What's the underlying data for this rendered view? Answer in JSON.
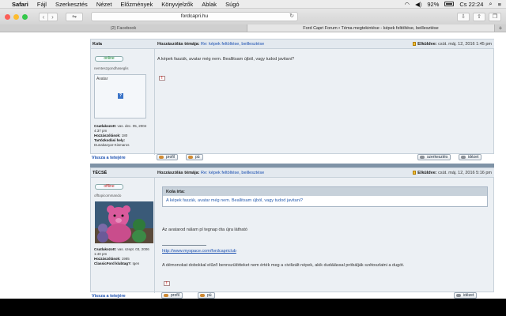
{
  "menubar": {
    "items": [
      "Safari",
      "Fájl",
      "Szerkesztés",
      "Nézet",
      "Előzmények",
      "Könyvjelzők",
      "Ablak",
      "Súgó"
    ],
    "battery": "92%",
    "clock": "Cs 22:24"
  },
  "toolbar": {
    "url": "fordcapri.hu"
  },
  "tabs": [
    {
      "label": "(2) Facebook"
    },
    {
      "label": "Ford Capri Forum • Téma megtekintése - képek feltöltése, beillesztése"
    }
  ],
  "posts": [
    {
      "author": "Kola",
      "status": "online",
      "rank": "nemteszgondhaseglis",
      "avatar_label": "Avatar",
      "subject_label": "Hozzászólás témája:",
      "subject": "Re: képek feltöltése, beillesztése",
      "sent_label": "Elküldve:",
      "sent": "csüt. máj. 12, 2016 1:45 pm",
      "body": "A képek faszák, avatar még nem. Beallitsam újból, vagy tudod javitani?",
      "stats": [
        {
          "k": "Csatlakozott:",
          "v": "vas. dec. 05, 2004 4:37 pm"
        },
        {
          "k": "Hozzászólások:",
          "v": "180"
        },
        {
          "k": "Tartózkodási hely:",
          "v": "Dunakanyar-Kismaros"
        }
      ],
      "back_to_top": "Vissza a tetejére",
      "buttons": {
        "profile": "profil",
        "pm": "pü",
        "edit": "szerkesztés",
        "quote": "idézet"
      }
    },
    {
      "author": "TÉCSÉ",
      "status": "offline",
      "rank": "offtopicommando",
      "subject_label": "Hozzászólás témája:",
      "subject": "Re: képek feltöltése, beillesztése",
      "sent_label": "Elküldve:",
      "sent": "csüt. máj. 12, 2016 5:16 pm",
      "quote_header": "Kola írta:",
      "quote_body": "A képek faszák, avatar még nem. Beallitsam újból, vagy tudod javitani?",
      "body1": "Az avatarod nálam pl tegnap óta újra látható",
      "link": "http://www.myspace.com/fordcapriclub",
      "body2": "A démonokat dobokkal elűző bennszülötteket nem érték meg a civilizált népek, akik dudálással próbálják szétoszlatni a dugót.",
      "stats": [
        {
          "k": "Csatlakozott:",
          "v": "vas. szept. 03, 2006 1:40 pm"
        },
        {
          "k": "Hozzászólások:",
          "v": "1985"
        },
        {
          "k": "ClassicFord klubtag?:",
          "v": "Igen"
        }
      ],
      "back_to_top": "Vissza a tetejére",
      "buttons": {
        "profile": "profil",
        "pm": "pü",
        "quote": "idézet"
      }
    }
  ]
}
